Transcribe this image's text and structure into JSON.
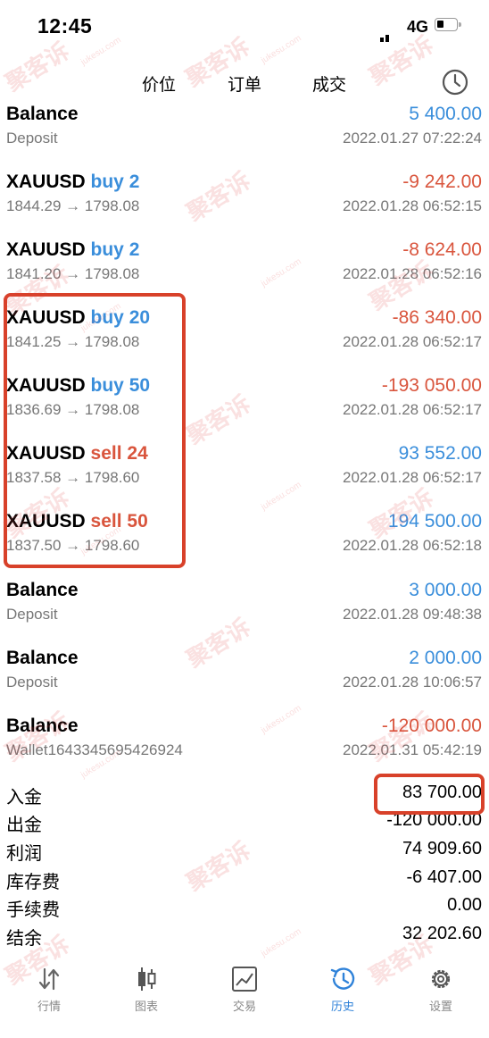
{
  "status": {
    "time": "12:45",
    "network": "4G"
  },
  "tabs": {
    "quotes": "价位",
    "orders": "订单",
    "deals": "成交"
  },
  "rows": [
    {
      "sym": "Balance",
      "side": "",
      "side_class": "",
      "amount": "5 400.00",
      "amount_class": "pos",
      "sub": "Deposit",
      "time": "2022.01.27 07:22:24"
    },
    {
      "sym": "XAUUSD",
      "side": "buy 2",
      "side_class": "buy",
      "amount": "-9 242.00",
      "amount_class": "neg",
      "sub": "1844.29 → 1798.08",
      "time": "2022.01.28 06:52:15"
    },
    {
      "sym": "XAUUSD",
      "side": "buy 2",
      "side_class": "buy",
      "amount": "-8 624.00",
      "amount_class": "neg",
      "sub": "1841.20 → 1798.08",
      "time": "2022.01.28 06:52:16"
    },
    {
      "sym": "XAUUSD",
      "side": "buy 20",
      "side_class": "buy",
      "amount": "-86 340.00",
      "amount_class": "neg",
      "sub": "1841.25 → 1798.08",
      "time": "2022.01.28 06:52:17"
    },
    {
      "sym": "XAUUSD",
      "side": "buy 50",
      "side_class": "buy",
      "amount": "-193 050.00",
      "amount_class": "neg",
      "sub": "1836.69 → 1798.08",
      "time": "2022.01.28 06:52:17"
    },
    {
      "sym": "XAUUSD",
      "side": "sell 24",
      "side_class": "sell",
      "amount": "93 552.00",
      "amount_class": "pos",
      "sub": "1837.58 → 1798.60",
      "time": "2022.01.28 06:52:17"
    },
    {
      "sym": "XAUUSD",
      "side": "sell 50",
      "side_class": "sell",
      "amount": "194 500.00",
      "amount_class": "pos",
      "sub": "1837.50 → 1798.60",
      "time": "2022.01.28 06:52:18"
    },
    {
      "sym": "Balance",
      "side": "",
      "side_class": "",
      "amount": "3 000.00",
      "amount_class": "pos",
      "sub": "Deposit",
      "time": "2022.01.28 09:48:38"
    },
    {
      "sym": "Balance",
      "side": "",
      "side_class": "",
      "amount": "2 000.00",
      "amount_class": "pos",
      "sub": "Deposit",
      "time": "2022.01.28 10:06:57"
    },
    {
      "sym": "Balance",
      "side": "",
      "side_class": "",
      "amount": "-120 000.00",
      "amount_class": "neg",
      "sub": "Wallet1643345695426924",
      "time": "2022.01.31 05:42:19"
    }
  ],
  "summary": [
    {
      "label": "入金",
      "value": "83 700.00"
    },
    {
      "label": "出金",
      "value": "-120 000.00"
    },
    {
      "label": "利润",
      "value": "74 909.60"
    },
    {
      "label": "库存费",
      "value": "-6 407.00"
    },
    {
      "label": "手续费",
      "value": "0.00"
    },
    {
      "label": "结余",
      "value": "32 202.60"
    }
  ],
  "nav": {
    "quotes": "行情",
    "chart": "图表",
    "trade": "交易",
    "history": "历史",
    "settings": "设置"
  },
  "watermark": {
    "text": "聚客诉",
    "domain": "jukesu.com"
  },
  "colors": {
    "buy": "#3a8edb",
    "sell": "#d9553d",
    "highlight": "#d8412a",
    "active_tab": "#2f82d9"
  }
}
